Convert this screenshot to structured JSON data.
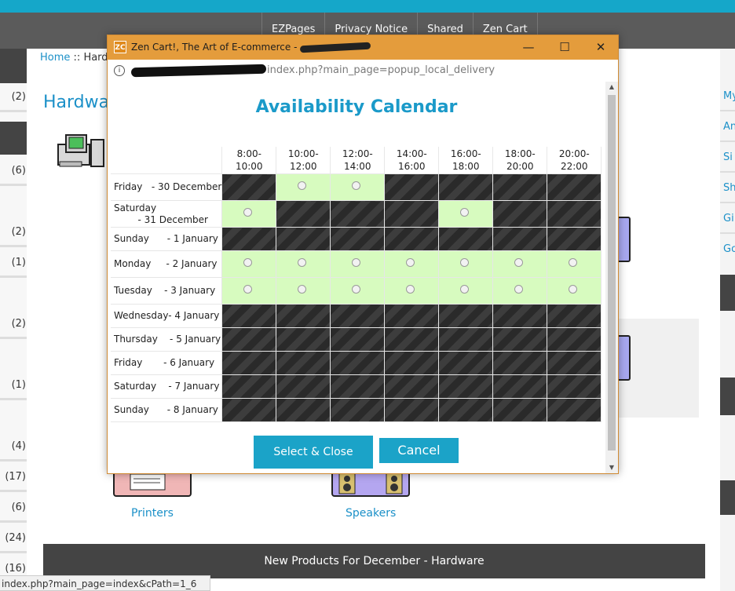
{
  "nav": {
    "links": [
      "EZPages",
      "Privacy Notice",
      "Shared",
      "Zen Cart"
    ]
  },
  "breadcrumb": {
    "home": "Home",
    "sep": "::",
    "current": "Hard"
  },
  "page": {
    "heading": "Hardwa"
  },
  "left_counts": [
    "(2)",
    "(6)",
    "(2)",
    "(1)",
    "(2)",
    "(1)",
    "(4)",
    "(17)",
    "(6)",
    "(24)",
    "(16)"
  ],
  "right_links": [
    "My",
    "An",
    "Si",
    "Sh",
    "Gi",
    "Go"
  ],
  "categories": [
    "Printers",
    "Speakers"
  ],
  "footer_heading": "New Products For December - Hardware",
  "status_url": "index.php?main_page=index&cPath=1_6",
  "popup": {
    "logo": "ZC",
    "window_title": "Zen Cart!, The Art of E-commerce -",
    "window_buttons": [
      "—",
      "☐",
      "✕"
    ],
    "info_icon": "i",
    "address": "index.php?main_page=popup_local_delivery",
    "calendar_title": "Availability Calendar",
    "slots": [
      [
        "8:00-",
        "10:00"
      ],
      [
        "10:00-",
        "12:00"
      ],
      [
        "12:00-",
        "14:00"
      ],
      [
        "14:00-",
        "16:00"
      ],
      [
        "16:00-",
        "18:00"
      ],
      [
        "18:00-",
        "20:00"
      ],
      [
        "20:00-",
        "22:00"
      ]
    ],
    "days": [
      {
        "label": "Friday   - 30 December",
        "avail": [
          0,
          1,
          1,
          0,
          0,
          0,
          0
        ]
      },
      {
        "label": "Saturday\n        - 31 December",
        "avail": [
          1,
          0,
          0,
          0,
          1,
          0,
          0
        ]
      },
      {
        "label": "Sunday      - 1 January",
        "avail": [
          0,
          0,
          0,
          0,
          0,
          0,
          0
        ]
      },
      {
        "label": "Monday     - 2 January",
        "avail": [
          1,
          1,
          1,
          1,
          1,
          1,
          1
        ]
      },
      {
        "label": "Tuesday    - 3 January",
        "avail": [
          1,
          1,
          1,
          1,
          1,
          1,
          1
        ]
      },
      {
        "label": "Wednesday- 4 January",
        "avail": [
          0,
          0,
          0,
          0,
          0,
          0,
          0
        ]
      },
      {
        "label": "Thursday    - 5 January",
        "avail": [
          0,
          0,
          0,
          0,
          0,
          0,
          0
        ]
      },
      {
        "label": "Friday       - 6 January",
        "avail": [
          0,
          0,
          0,
          0,
          0,
          0,
          0
        ]
      },
      {
        "label": "Saturday    - 7 January",
        "avail": [
          0,
          0,
          0,
          0,
          0,
          0,
          0
        ]
      },
      {
        "label": "Sunday      - 8 January",
        "avail": [
          0,
          0,
          0,
          0,
          0,
          0,
          0
        ]
      }
    ],
    "select_button": "Select & Close",
    "cancel_button": "Cancel"
  }
}
